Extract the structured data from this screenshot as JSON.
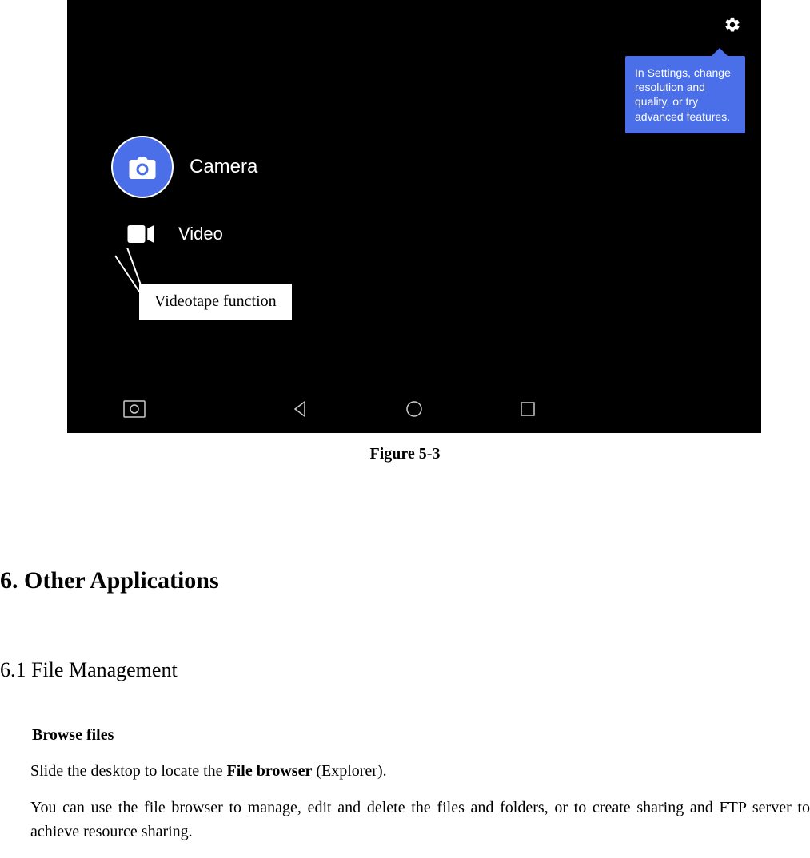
{
  "screenshot": {
    "tooltip": "In Settings, change resolution and quality, or try advanced features.",
    "camera_label": "Camera",
    "video_label": "Video",
    "annotation": "Videotape function"
  },
  "figure_caption": "Figure 5-3",
  "section": {
    "h1": "6. Other Applications",
    "h2": "6.1 File Management",
    "h3": "Browse files",
    "p1_a": "Slide the desktop to locate the ",
    "p1_b": "File browser",
    "p1_c": " (Explorer).",
    "p2": "You can use the file browser to manage, edit and delete the files and folders, or to create sharing and FTP server to achieve resource sharing."
  }
}
